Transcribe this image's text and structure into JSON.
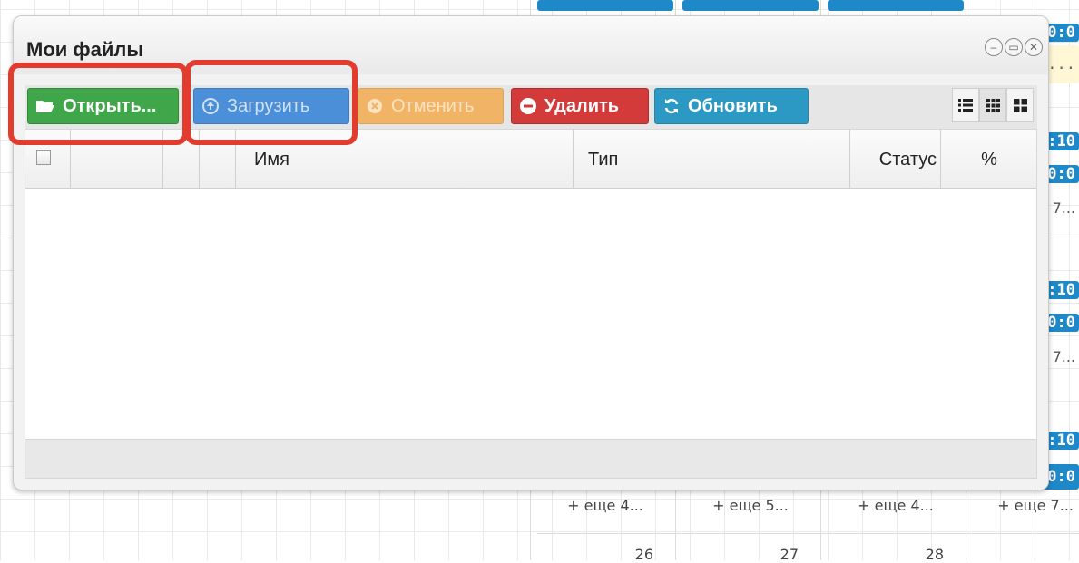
{
  "calendar": {
    "events": [
      [
        "0:0",
        "7..."
      ],
      [
        ":10",
        "0:0",
        "7..."
      ],
      [
        ":10",
        "0:0",
        "7..."
      ],
      [
        ":10",
        "0:0"
      ]
    ],
    "more": [
      "+ еще 4...",
      "+ еще 5...",
      "+ еще 4...",
      "+ еще 7..."
    ],
    "days": [
      "26",
      "27",
      "28"
    ]
  },
  "window": {
    "title": "Мои файлы",
    "controls": {
      "minimize": "–",
      "maximize": "▭",
      "close": "✕"
    }
  },
  "toolbar": {
    "open_label": "Открыть...",
    "upload_label": "Загрузить",
    "cancel_label": "Отменить",
    "delete_label": "Удалить",
    "refresh_label": "Обновить",
    "view_modes": [
      "list",
      "small-icons",
      "large-icons"
    ]
  },
  "table": {
    "columns": [
      "",
      "",
      "",
      "Имя",
      "Тип",
      "Статус",
      "%"
    ],
    "rows": []
  },
  "colors": {
    "open": "#3fa74a",
    "upload": "#4b8fd8",
    "cancel": "#f1b466",
    "delete": "#d33a3a",
    "refresh": "#2c98c4",
    "annotation": "#e23c2e",
    "event": "#1e88c8"
  }
}
